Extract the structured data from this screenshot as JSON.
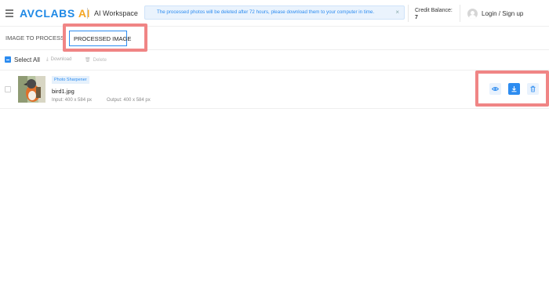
{
  "header": {
    "logo_main": "AVCLABS",
    "logo_ai": "AI",
    "workspace": "AI Workspace",
    "notice": "The processed photos will be deleted after 72 hours, please download them to your computer in time.",
    "notice_close": "×",
    "credit_label": "Credit Balance:",
    "credit_value": "7",
    "login": "Login / Sign up"
  },
  "tabs": {
    "image_to_process": "IMAGE TO PROCESS",
    "processed_image": "PROCESSED IMAGE"
  },
  "toolbar": {
    "select_all": "Select All",
    "download": "Download",
    "delete": "Delete"
  },
  "items": [
    {
      "badge": "Photo Sharpener",
      "filename": "bird1.jpg",
      "input": "Input: 400 x 584 px",
      "output": "Output: 400 x 584 px"
    }
  ],
  "icons": {
    "menu": "hamburger-menu-icon",
    "avatar": "user-avatar-icon",
    "view": "eye-icon",
    "download": "download-icon",
    "delete": "trash-icon"
  },
  "colors": {
    "brand": "#1e88e5",
    "ai_accent": "#f5a623",
    "primary": "#2d8cf0",
    "highlight": "#f08585",
    "notice_bg": "#eaf3fd"
  }
}
